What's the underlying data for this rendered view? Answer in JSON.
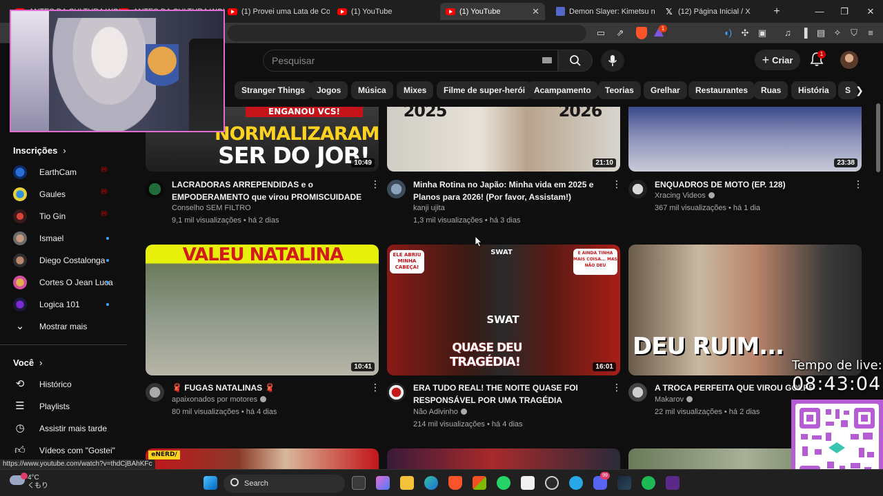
{
  "browser": {
    "tabs": [
      {
        "label": "ANTES DA CULTURA WOKE",
        "icon": "youtube-icon"
      },
      {
        "label": "ANTES DA CULTURA WOKE",
        "icon": "youtube-icon"
      },
      {
        "label": "(1) Provei uma Lata de Com",
        "icon": "youtube-icon"
      },
      {
        "label": "(1) YouTube",
        "icon": "youtube-icon"
      },
      {
        "label": "(1) YouTube",
        "icon": "youtube-icon",
        "active": true
      },
      {
        "label": "Demon Slayer: Kimetsu no Y",
        "icon": "demon-slayer-icon"
      },
      {
        "label": "(12) Página Inicial / X",
        "icon": "x-icon"
      }
    ],
    "new_tab": "+",
    "rewards_badge": "1",
    "status_url": "https://www.youtube.com/watch?v=thdCjBAhKFc"
  },
  "youtube": {
    "search_placeholder": "Pesquisar",
    "create_label": "Criar",
    "notifications_count": "1",
    "chips": [
      "Stranger Things",
      "Jogos",
      "Música",
      "Mixes",
      "Filme de super-herói",
      "Acampamento",
      "Teorias",
      "Grelhar",
      "Restaurantes",
      "Ruas",
      "História",
      "S"
    ]
  },
  "sidebar": {
    "subscriptions_title": "Inscrições",
    "subscriptions": [
      {
        "name": "EarthCam",
        "status": "live"
      },
      {
        "name": "Gaules",
        "status": "live"
      },
      {
        "name": "Tio Gin",
        "status": "live"
      },
      {
        "name": "Ismael",
        "status": "new"
      },
      {
        "name": "Diego Costalonga",
        "status": "new"
      },
      {
        "name": "Cortes O Jean Luca",
        "status": "new"
      },
      {
        "name": "Logica 101",
        "status": "new"
      }
    ],
    "show_more": "Mostrar mais",
    "you_title": "Você",
    "you_items": [
      {
        "label": "Histórico",
        "icon": "history-icon"
      },
      {
        "label": "Playlists",
        "icon": "playlists-icon"
      },
      {
        "label": "Assistir mais tarde",
        "icon": "watch-later-icon"
      },
      {
        "label": "Vídeos com \"Gostei\"",
        "icon": "like-icon"
      }
    ]
  },
  "videos": [
    {
      "title": "LACRADORAS ARREPENDIDAS e o EMPODERAMENTO que virou PROMISCUIDADE",
      "channel": "Conselho SEM FILTRO",
      "verified": false,
      "meta": "9,1 mil visualizações • há 2 dias",
      "duration": "10:49",
      "thumb_text": [
        "ENGANOU VCS!",
        "NORMALIZARAM",
        "SER DO JOB!"
      ]
    },
    {
      "title": "Minha Rotina no Japão: Minha vida em 2025 e Planos para 2026!          (Por favor, Assistam!)",
      "channel": "kanji ujita",
      "verified": false,
      "meta": "1,3 mil visualizações • há 3 dias",
      "duration": "21:10",
      "thumb_text": [
        "2025",
        "2026"
      ]
    },
    {
      "title": "ENQUADROS DE MOTO (EP. 128)",
      "channel": "Xracing Videos",
      "verified": true,
      "meta": "367 mil visualizações • há 1 dia",
      "duration": "23:38",
      "thumb_text": []
    },
    {
      "title": "🧣 FUGAS NATALINAS 🧣",
      "channel": "apaixonados por motores",
      "verified": true,
      "meta": "80 mil visualizações • há 4 dias",
      "duration": "10:41",
      "thumb_text": [
        "VALEU NATALINA"
      ]
    },
    {
      "title": "ERA TUDO REAL! THE NOITE QUASE FOI RESPONSÁVEL POR UMA TRAGÉDIA",
      "channel": "Não Adivinho",
      "verified": true,
      "meta": "214 mil visualizações • há 4 dias",
      "duration": "16:01",
      "thumb_text": [
        "ELE ABRIU MINHA CABEÇA!",
        "SWAT",
        "SWAT",
        "E AINDA TINHA MAIS COISA... MAS NÃO DEU",
        "QUASE DEU",
        "TRAGÉDIA!"
      ]
    },
    {
      "title": "A TROCA PERFEITA QUE VIROU GOLPE",
      "channel": "Makarov",
      "verified": true,
      "meta": "22 mil visualizações • há 2 dias",
      "duration": "",
      "thumb_text": [
        "DEU RUIM..."
      ]
    }
  ],
  "next_row_labels": [
    "eNERD/"
  ],
  "overlay": {
    "label": "Tempo de live:",
    "timer": "08:43:04"
  },
  "taskbar": {
    "weather_temp": "4°C",
    "weather_desc": "くもり",
    "search_label": "Search",
    "discord_badge": "99"
  },
  "colors": {
    "yt_bg": "#0f0f0f",
    "accent_red": "#ff0000",
    "chip_bg": "#272727",
    "overlay_frame": "#b65dd6"
  }
}
